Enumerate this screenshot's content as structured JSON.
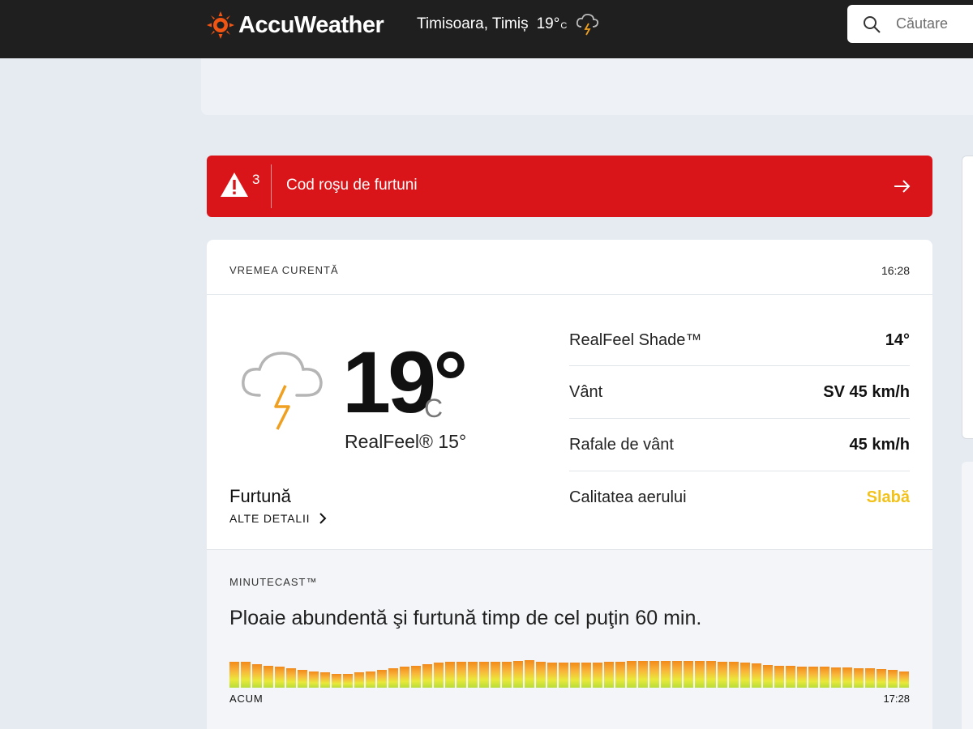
{
  "header": {
    "logo_text": "AccuWeather",
    "location": "Timisoara, Timiș",
    "temp": "19°",
    "temp_unit": "C",
    "search_placeholder": "Căutare"
  },
  "alert": {
    "count": "3",
    "message": "Cod roşu de furtuni"
  },
  "current": {
    "title": "VREMEA CURENTĂ",
    "time": "16:28",
    "temperature": "19°",
    "unit": "C",
    "realfeel": "RealFeel® 15°",
    "condition": "Furtună",
    "more_label": "ALTE DETALII",
    "details": [
      {
        "label": "RealFeel Shade™",
        "value": "14°"
      },
      {
        "label": "Vânt",
        "value": "SV 45 km/h"
      },
      {
        "label": "Rafale de vânt",
        "value": "45 km/h"
      },
      {
        "label": "Calitatea aerului",
        "value": "Slabă"
      }
    ]
  },
  "minutecast": {
    "title": "MINUTECAST™",
    "summary": "Ploaie abundentă şi furtună timp de cel puţin 60 min.",
    "start_label": "ACUM",
    "end_label": "17:28",
    "intensity": [
      0.95,
      0.95,
      0.85,
      0.8,
      0.75,
      0.7,
      0.65,
      0.6,
      0.55,
      0.5,
      0.5,
      0.55,
      0.6,
      0.65,
      0.7,
      0.75,
      0.8,
      0.85,
      0.9,
      0.95,
      0.95,
      0.95,
      0.95,
      0.95,
      0.95,
      0.97,
      1.0,
      0.95,
      0.9,
      0.9,
      0.9,
      0.9,
      0.92,
      0.93,
      0.95,
      0.97,
      0.97,
      0.97,
      0.97,
      0.97,
      0.97,
      0.97,
      0.96,
      0.95,
      0.93,
      0.9,
      0.87,
      0.83,
      0.8,
      0.78,
      0.76,
      0.75,
      0.75,
      0.74,
      0.73,
      0.72,
      0.7,
      0.68,
      0.65,
      0.6
    ]
  },
  "colors": {
    "header_bg": "#1f1f1f",
    "alert_red": "#d91519",
    "logo_orange": "#f05514",
    "air_quality_poor": "#f2c21b"
  }
}
